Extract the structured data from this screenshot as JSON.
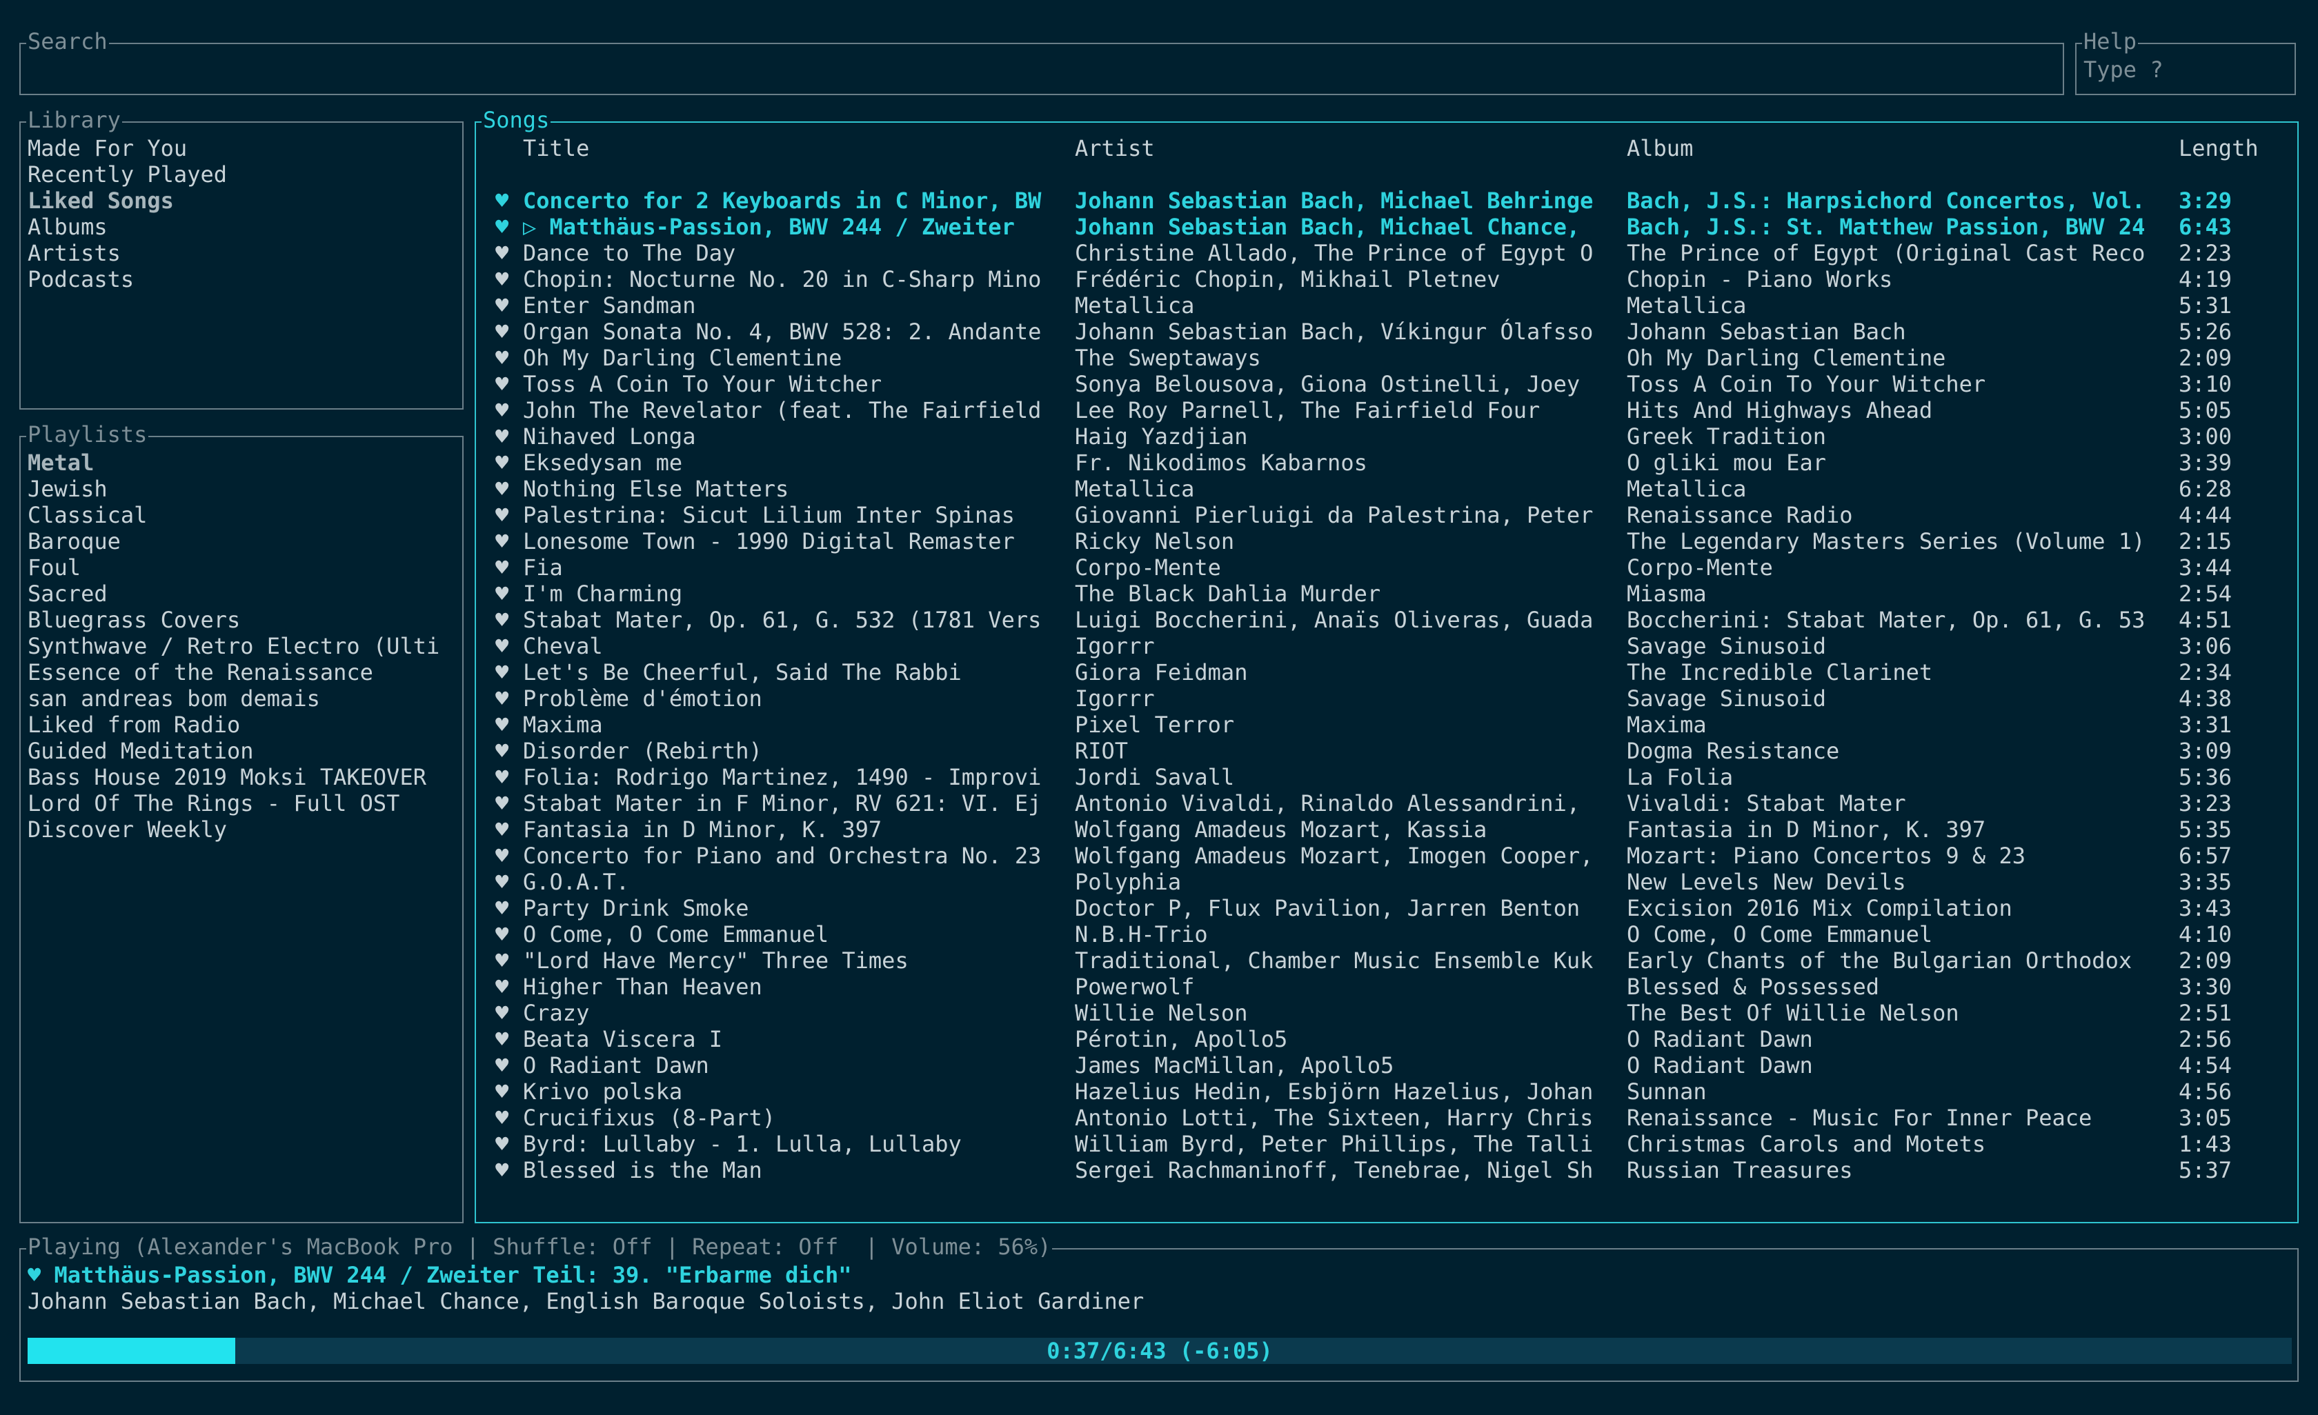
{
  "search": {
    "title": "Search",
    "value": ""
  },
  "help": {
    "title": "Help",
    "text": "Type ?"
  },
  "library": {
    "title": "Library",
    "items": [
      {
        "label": "Made For You"
      },
      {
        "label": "Recently Played"
      },
      {
        "label": "Liked Songs",
        "selected": true
      },
      {
        "label": "Albums"
      },
      {
        "label": "Artists"
      },
      {
        "label": "Podcasts"
      }
    ]
  },
  "playlists": {
    "title": "Playlists",
    "items": [
      {
        "label": "Metal",
        "selected": true
      },
      {
        "label": "Jewish"
      },
      {
        "label": "Classical"
      },
      {
        "label": "Baroque"
      },
      {
        "label": "Foul"
      },
      {
        "label": "Sacred"
      },
      {
        "label": "Bluegrass Covers"
      },
      {
        "label": "Synthwave / Retro Electro (Ulti"
      },
      {
        "label": "Essence of the Renaissance"
      },
      {
        "label": "san andreas bom demais"
      },
      {
        "label": "Liked from Radio"
      },
      {
        "label": "Guided Meditation"
      },
      {
        "label": "Bass House 2019 Moksi TAKEOVER"
      },
      {
        "label": "Lord Of The Rings - Full OST"
      },
      {
        "label": "Discover Weekly"
      }
    ]
  },
  "songs": {
    "title": "Songs",
    "heart": "♥",
    "columns": {
      "title": "Title",
      "artist": "Artist",
      "album": "Album",
      "length": "Length"
    },
    "rows": [
      {
        "title": "Concerto for 2 Keyboards in C Minor, BW",
        "artist": "Johann Sebastian Bach, Michael Behringe",
        "album": "Bach, J.S.: Harpsichord Concertos, Vol.",
        "length": "3:29",
        "highlight": true
      },
      {
        "title": "▷ Matthäus-Passion, BWV 244 / Zweiter",
        "artist": "Johann Sebastian Bach, Michael Chance,",
        "album": "Bach, J.S.: St. Matthew Passion, BWV 24",
        "length": "6:43",
        "highlight": true
      },
      {
        "title": "Dance to The Day",
        "artist": "Christine Allado, The Prince of Egypt O",
        "album": "The Prince of Egypt (Original Cast Reco",
        "length": "2:23"
      },
      {
        "title": "Chopin: Nocturne No. 20 in C-Sharp Mino",
        "artist": "Frédéric Chopin, Mikhail Pletnev",
        "album": "Chopin - Piano Works",
        "length": "4:19"
      },
      {
        "title": "Enter Sandman",
        "artist": "Metallica",
        "album": "Metallica",
        "length": "5:31"
      },
      {
        "title": "Organ Sonata No. 4, BWV 528: 2. Andante",
        "artist": "Johann Sebastian Bach, Víkingur Ólafsso",
        "album": "Johann Sebastian Bach",
        "length": "5:26"
      },
      {
        "title": "Oh My Darling Clementine",
        "artist": "The Sweptaways",
        "album": "Oh My Darling Clementine",
        "length": "2:09"
      },
      {
        "title": "Toss A Coin To Your Witcher",
        "artist": "Sonya Belousova, Giona Ostinelli, Joey",
        "album": "Toss A Coin To Your Witcher",
        "length": "3:10"
      },
      {
        "title": "John The Revelator (feat. The Fairfield",
        "artist": "Lee Roy Parnell, The Fairfield Four",
        "album": "Hits And Highways Ahead",
        "length": "5:05"
      },
      {
        "title": "Nihaved Longa",
        "artist": "Haig Yazdjian",
        "album": "Greek Tradition",
        "length": "3:00"
      },
      {
        "title": "Eksedysan me",
        "artist": "Fr. Nikodimos Kabarnos",
        "album": "O gliki mou Ear",
        "length": "3:39"
      },
      {
        "title": "Nothing Else Matters",
        "artist": "Metallica",
        "album": "Metallica",
        "length": "6:28"
      },
      {
        "title": "Palestrina: Sicut Lilium Inter Spinas",
        "artist": "Giovanni Pierluigi da Palestrina, Peter",
        "album": "Renaissance Radio",
        "length": "4:44"
      },
      {
        "title": "Lonesome Town - 1990 Digital Remaster",
        "artist": "Ricky Nelson",
        "album": "The Legendary Masters Series (Volume 1)",
        "length": "2:15"
      },
      {
        "title": "Fia",
        "artist": "Corpo-Mente",
        "album": "Corpo-Mente",
        "length": "3:44"
      },
      {
        "title": "I'm Charming",
        "artist": "The Black Dahlia Murder",
        "album": "Miasma",
        "length": "2:54"
      },
      {
        "title": "Stabat Mater, Op. 61, G. 532 (1781 Vers",
        "artist": "Luigi Boccherini, Anaïs Oliveras, Guada",
        "album": "Boccherini: Stabat Mater, Op. 61, G. 53",
        "length": "4:51"
      },
      {
        "title": "Cheval",
        "artist": "Igorrr",
        "album": "Savage Sinusoid",
        "length": "3:06"
      },
      {
        "title": "Let's Be Cheerful, Said The Rabbi",
        "artist": "Giora Feidman",
        "album": "The Incredible Clarinet",
        "length": "2:34"
      },
      {
        "title": "Problème d'émotion",
        "artist": "Igorrr",
        "album": "Savage Sinusoid",
        "length": "4:38"
      },
      {
        "title": "Maxima",
        "artist": "Pixel Terror",
        "album": "Maxima",
        "length": "3:31"
      },
      {
        "title": "Disorder (Rebirth)",
        "artist": "RIOT",
        "album": "Dogma Resistance",
        "length": "3:09"
      },
      {
        "title": "Folia: Rodrigo Martinez, 1490 - Improvi",
        "artist": "Jordi Savall",
        "album": "La Folia",
        "length": "5:36"
      },
      {
        "title": "Stabat Mater in F Minor, RV 621: VI. Ej",
        "artist": "Antonio Vivaldi, Rinaldo Alessandrini,",
        "album": "Vivaldi: Stabat Mater",
        "length": "3:23"
      },
      {
        "title": "Fantasia in D Minor, K. 397",
        "artist": "Wolfgang Amadeus Mozart, Kassia",
        "album": "Fantasia in D Minor, K. 397",
        "length": "5:35"
      },
      {
        "title": "Concerto for Piano and Orchestra No. 23",
        "artist": "Wolfgang Amadeus Mozart, Imogen Cooper,",
        "album": "Mozart: Piano Concertos 9 & 23",
        "length": "6:57"
      },
      {
        "title": "G.O.A.T.",
        "artist": "Polyphia",
        "album": "New Levels New Devils",
        "length": "3:35"
      },
      {
        "title": "Party Drink Smoke",
        "artist": "Doctor P, Flux Pavilion, Jarren Benton",
        "album": "Excision 2016 Mix Compilation",
        "length": "3:43"
      },
      {
        "title": "O Come, O Come Emmanuel",
        "artist": "N.B.H-Trio",
        "album": "O Come, O Come Emmanuel",
        "length": "4:10"
      },
      {
        "title": "\"Lord Have Mercy\" Three Times",
        "artist": "Traditional, Chamber Music Ensemble Kuk",
        "album": "Early Chants of the Bulgarian Orthodox",
        "length": "2:09"
      },
      {
        "title": "Higher Than Heaven",
        "artist": "Powerwolf",
        "album": "Blessed & Possessed",
        "length": "3:30"
      },
      {
        "title": "Crazy",
        "artist": "Willie Nelson",
        "album": "The Best Of Willie Nelson",
        "length": "2:51"
      },
      {
        "title": "Beata Viscera I",
        "artist": "Pérotin, Apollo5",
        "album": "O Radiant Dawn",
        "length": "2:56"
      },
      {
        "title": "O Radiant Dawn",
        "artist": "James MacMillan, Apollo5",
        "album": "O Radiant Dawn",
        "length": "4:54"
      },
      {
        "title": "Krivo polska",
        "artist": "Hazelius Hedin, Esbjörn Hazelius, Johan",
        "album": "Sunnan",
        "length": "4:56"
      },
      {
        "title": "Crucifixus (8-Part)",
        "artist": "Antonio Lotti, The Sixteen, Harry Chris",
        "album": "Renaissance - Music For Inner Peace",
        "length": "3:05"
      },
      {
        "title": "Byrd: Lullaby - 1. Lulla, Lullaby",
        "artist": "William Byrd, Peter Phillips, The Talli",
        "album": "Christmas Carols and Motets",
        "length": "1:43"
      },
      {
        "title": "Blessed is the Man",
        "artist": "Sergei Rachmaninoff, Tenebrae, Nigel Sh",
        "album": "Russian Treasures",
        "length": "5:37"
      }
    ]
  },
  "player": {
    "title": "Playing (Alexander's MacBook Pro | Shuffle: Off | Repeat: Off  | Volume: 56%)",
    "now_title": "♥ Matthäus-Passion, BWV 244 / Zweiter Teil: 39. \"Erbarme dich\"",
    "now_artist": "Johann Sebastian Bach, Michael Chance, English Baroque Soloists, John Eliot Gardiner",
    "progress_text": "0:37/6:43 (-6:05)",
    "progress_fraction": 0.0918
  },
  "colors": {
    "background": "#00202f",
    "accent": "#2fd3de",
    "border": "#6b7f89",
    "progress_fill": "#22e3ee",
    "progress_track": "#0b3a4e"
  }
}
